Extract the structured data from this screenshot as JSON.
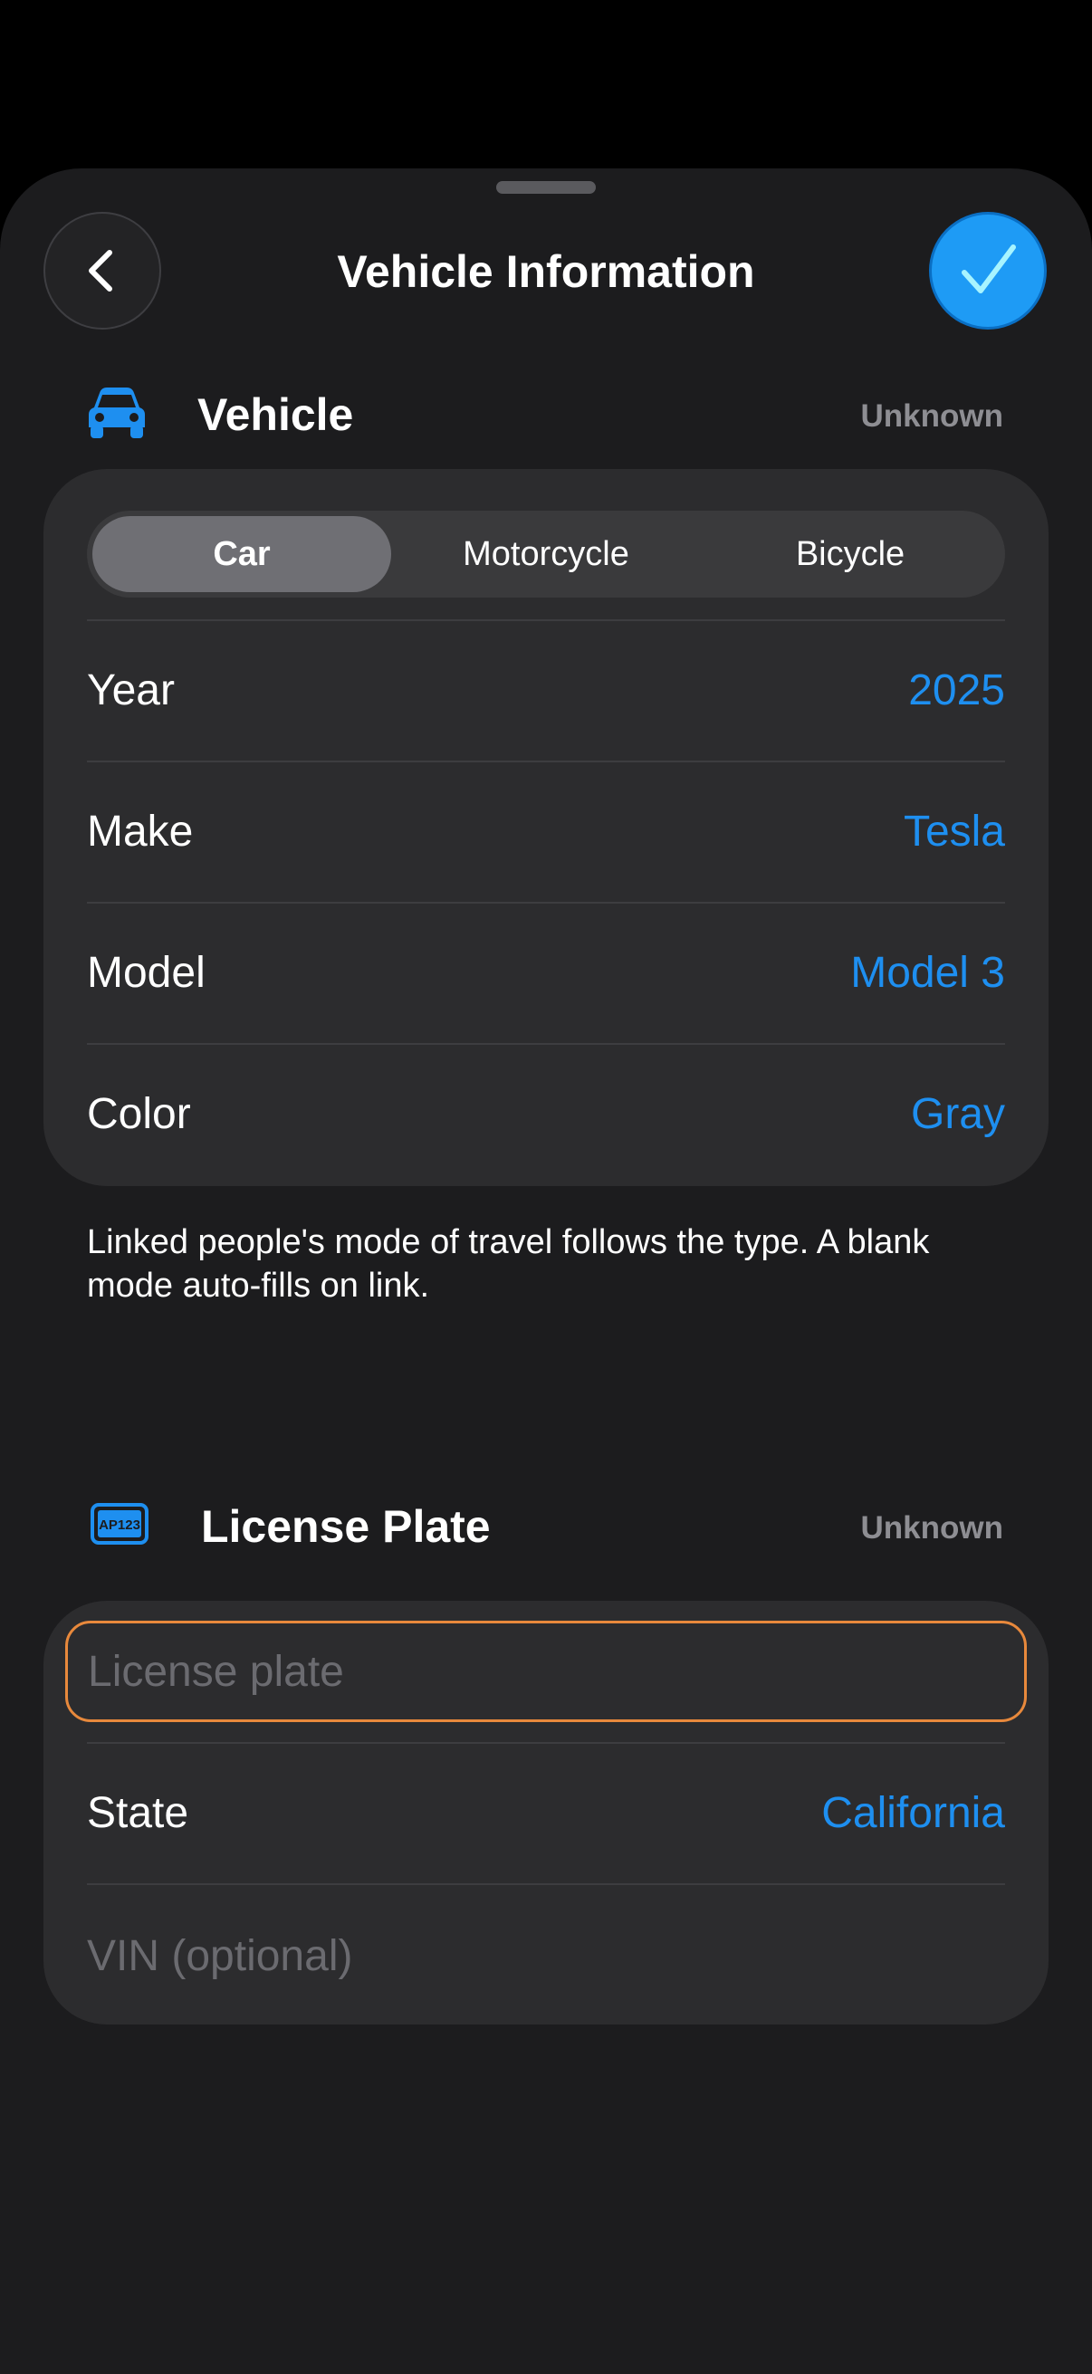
{
  "header": {
    "title": "Vehicle Information",
    "back_icon": "chevron-left-icon",
    "confirm_icon": "checkmark-icon"
  },
  "vehicle_section": {
    "title": "Vehicle",
    "status": "Unknown",
    "icon": "car-icon",
    "types": [
      {
        "label": "Car",
        "selected": true
      },
      {
        "label": "Motorcycle",
        "selected": false
      },
      {
        "label": "Bicycle",
        "selected": false
      }
    ],
    "rows": [
      {
        "label": "Year",
        "value": "2025"
      },
      {
        "label": "Make",
        "value": "Tesla"
      },
      {
        "label": "Model",
        "value": "Model 3"
      },
      {
        "label": "Color",
        "value": "Gray"
      }
    ],
    "footnote": "Linked people's mode of travel follows the type. A blank mode auto-fills on link."
  },
  "plate_section": {
    "title": "License Plate",
    "status": "Unknown",
    "icon": "license-plate-icon",
    "icon_text": "AP123",
    "plate_placeholder": "License plate",
    "state_label": "State",
    "state_value": "California",
    "vin_placeholder": "VIN (optional)"
  },
  "colors": {
    "accent": "#1e8ff0",
    "confirm": "#1e9bf5",
    "focus_border": "#e8893c"
  }
}
